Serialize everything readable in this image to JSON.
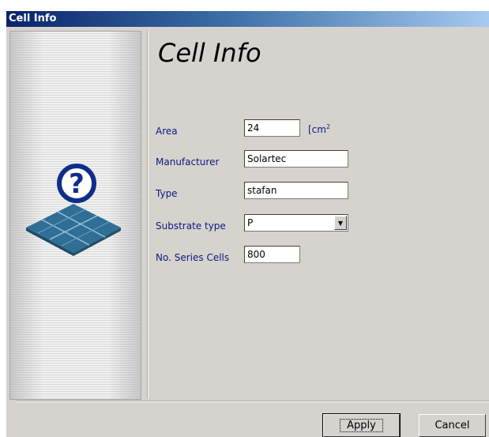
{
  "window": {
    "title": "Cell Info"
  },
  "heading": "Cell Info",
  "fields": {
    "area": {
      "label": "Area",
      "value": "24",
      "unit": "[cm",
      "unit_sup": "2"
    },
    "manufacturer": {
      "label": "Manufacturer",
      "value": "Solartec"
    },
    "type": {
      "label": "Type",
      "value": "stafan"
    },
    "substrate": {
      "label": "Substrate type",
      "value": "P"
    },
    "series_cells": {
      "label": "No. Series Cells",
      "value": "800"
    }
  },
  "buttons": {
    "apply": "Apply",
    "cancel": "Cancel"
  },
  "icons": {
    "help": "question-mark-icon",
    "solar": "solar-panel-icon",
    "dropdown": "chevron-down-icon"
  }
}
